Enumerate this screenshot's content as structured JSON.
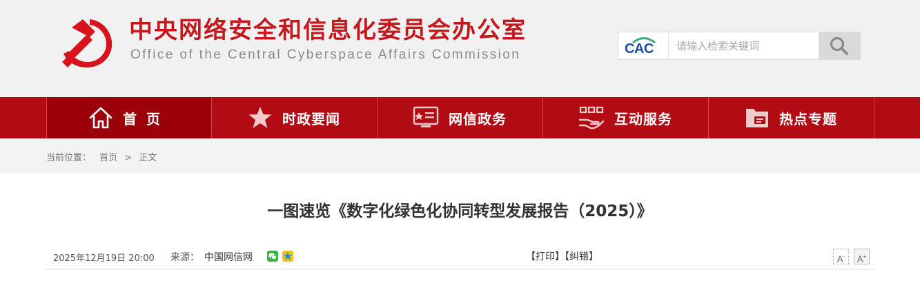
{
  "header": {
    "title_cn": "中央网络安全和信息化委员会办公室",
    "title_en": "Office of the Central Cyberspace Affairs Commission",
    "logo_text": "CAC",
    "search_placeholder": "请输入检索关键词",
    "brand_color": "#c8161d"
  },
  "nav": {
    "items": [
      {
        "label": "首页",
        "icon": "home-icon"
      },
      {
        "label": "时政要闻",
        "icon": "star-icon"
      },
      {
        "label": "网信政务",
        "icon": "monitor-icon"
      },
      {
        "label": "互动服务",
        "icon": "hands-icon"
      },
      {
        "label": "热点专题",
        "icon": "folder-icon"
      }
    ],
    "active_index": 0,
    "background": "#b30b14"
  },
  "breadcrumb": {
    "label": "当前位置：",
    "items": [
      "首页",
      "正文"
    ],
    "separator": ">"
  },
  "article": {
    "title": "一图速览《数字化绿色化协同转型发展报告（2025）》",
    "date": "2025年12月19日 20:00",
    "source_label": "来源：",
    "source": "中国网信网",
    "share": [
      "wechat-icon",
      "qzone-icon"
    ],
    "print_label": "【打印】",
    "correction_label": "【纠错】",
    "font_small_label": "A",
    "font_small_suffix": "-",
    "font_large_label": "A",
    "font_large_suffix": "+"
  }
}
